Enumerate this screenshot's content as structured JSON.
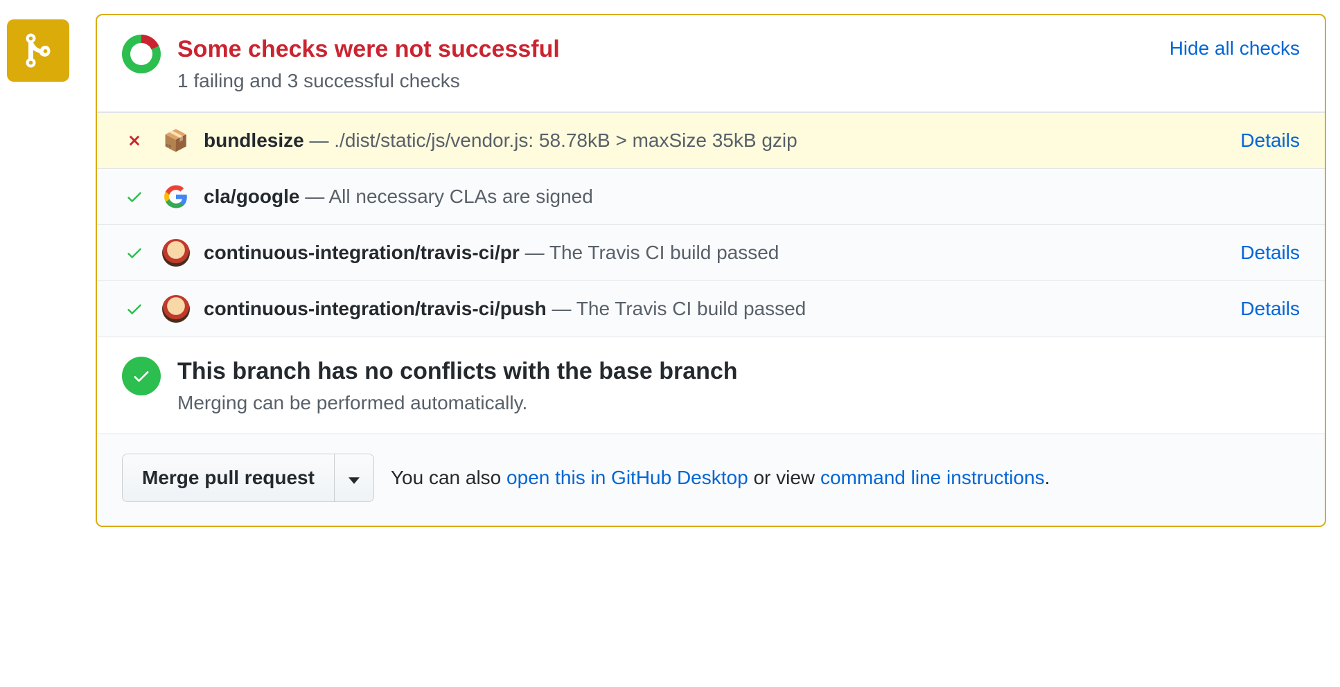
{
  "summary": {
    "title": "Some checks were not successful",
    "subtitle": "1 failing and 3 successful checks",
    "hide_label": "Hide all checks"
  },
  "checks": [
    {
      "status": "fail",
      "avatar": "package",
      "name": "bundlesize",
      "desc": "./dist/static/js/vendor.js: 58.78kB > maxSize 35kB gzip",
      "details": "Details"
    },
    {
      "status": "pass",
      "avatar": "google",
      "name": "cla/google",
      "desc": "All necessary CLAs are signed",
      "details": ""
    },
    {
      "status": "pass",
      "avatar": "travis",
      "name": "continuous-integration/travis-ci/pr",
      "desc": "The Travis CI build passed",
      "details": "Details"
    },
    {
      "status": "pass",
      "avatar": "travis",
      "name": "continuous-integration/travis-ci/push",
      "desc": "The Travis CI build passed",
      "details": "Details"
    }
  ],
  "conflicts": {
    "title": "This branch has no conflicts with the base branch",
    "subtitle": "Merging can be performed automatically."
  },
  "actions": {
    "merge_label": "Merge pull request",
    "text_prefix": "You can also ",
    "link1": "open this in GitHub Desktop",
    "text_mid": " or view ",
    "link2": "command line instructions",
    "text_suffix": "."
  }
}
